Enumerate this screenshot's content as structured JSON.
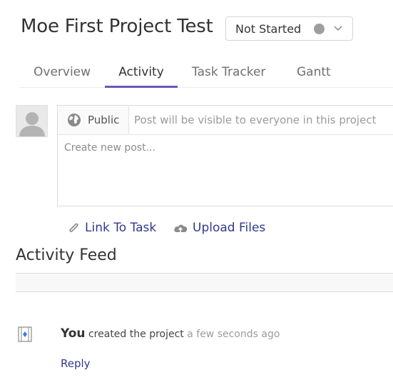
{
  "header": {
    "project_title": "Moe First Project Test",
    "status": {
      "label": "Not Started",
      "dot_color": "#9e9e9e"
    }
  },
  "tabs": [
    {
      "label": "Overview",
      "active": false
    },
    {
      "label": "Activity",
      "active": true
    },
    {
      "label": "Task Tracker",
      "active": false
    },
    {
      "label": "Gantt",
      "active": false
    }
  ],
  "composer": {
    "visibility_label": "Public",
    "visibility_hint": "Post will be visible to everyone in this project",
    "placeholder": "Create new post..."
  },
  "actions": {
    "link_task_label": "Link To Task",
    "upload_files_label": "Upload Files"
  },
  "feed": {
    "title": "Activity Feed",
    "items": [
      {
        "actor": "You",
        "action": "created the project",
        "time": "a few seconds ago",
        "reply_label": "Reply"
      }
    ]
  },
  "colors": {
    "accent": "#6b58b6",
    "link": "#2e3a8c"
  },
  "icons": {
    "chevron": "chevron-down-icon",
    "globe": "globe-icon",
    "link": "paperclip-icon",
    "upload": "cloud-upload-icon",
    "project": "project-icon",
    "avatar": "user-avatar-icon"
  }
}
